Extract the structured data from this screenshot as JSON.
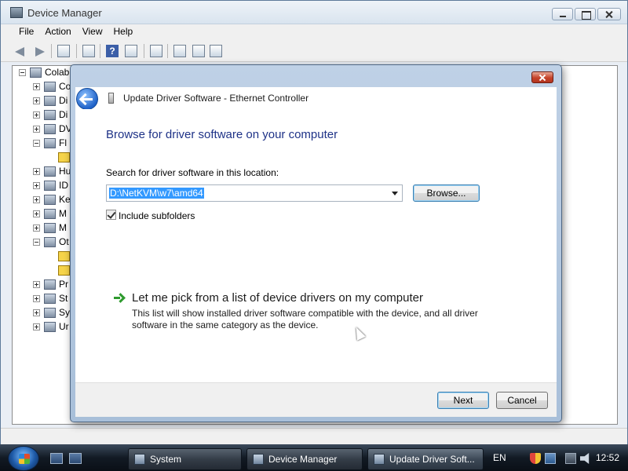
{
  "device_manager": {
    "title": "Device Manager",
    "menu": [
      "File",
      "Action",
      "View",
      "Help"
    ],
    "tree": {
      "root": "Colab",
      "items": [
        {
          "label": "Co",
          "icon": "computer-icon"
        },
        {
          "label": "Di",
          "icon": "disk-drive-icon"
        },
        {
          "label": "Di",
          "icon": "display-adapter-icon"
        },
        {
          "label": "DV",
          "icon": "dvd-drive-icon"
        },
        {
          "label": "Fl",
          "icon": "floppy-icon"
        },
        {
          "label": "Hu",
          "icon": "hid-icon"
        },
        {
          "label": "ID",
          "icon": "ide-controller-icon"
        },
        {
          "label": "Ke",
          "icon": "keyboard-icon"
        },
        {
          "label": "M",
          "icon": "mouse-icon"
        },
        {
          "label": "M",
          "icon": "monitor-icon"
        },
        {
          "label": "Ot",
          "icon": "other-devices-icon"
        },
        {
          "label": "Pr",
          "icon": "processor-icon"
        },
        {
          "label": "St",
          "icon": "storage-controller-icon"
        },
        {
          "label": "Sy",
          "icon": "system-device-icon"
        },
        {
          "label": "Ur",
          "icon": "usb-controller-icon"
        }
      ]
    }
  },
  "dialog": {
    "title": "Update Driver Software - Ethernet Controller",
    "heading": "Browse for driver software on your computer",
    "search_label": "Search for driver software in this location:",
    "path_value": "D:\\NetKVM\\w7\\amd64",
    "browse_label": "Browse...",
    "include_subfolders_label": "Include subfolders",
    "include_subfolders_checked": true,
    "pick_link": "Let me pick from a list of device drivers on my computer",
    "pick_description": "This list will show installed driver software compatible with the device, and all driver software in the same category as the device.",
    "next_label": "Next",
    "cancel_label": "Cancel"
  },
  "taskbar": {
    "tasks": [
      "System",
      "Device Manager",
      "Update Driver Soft..."
    ],
    "language": "EN",
    "clock": "12:52"
  }
}
